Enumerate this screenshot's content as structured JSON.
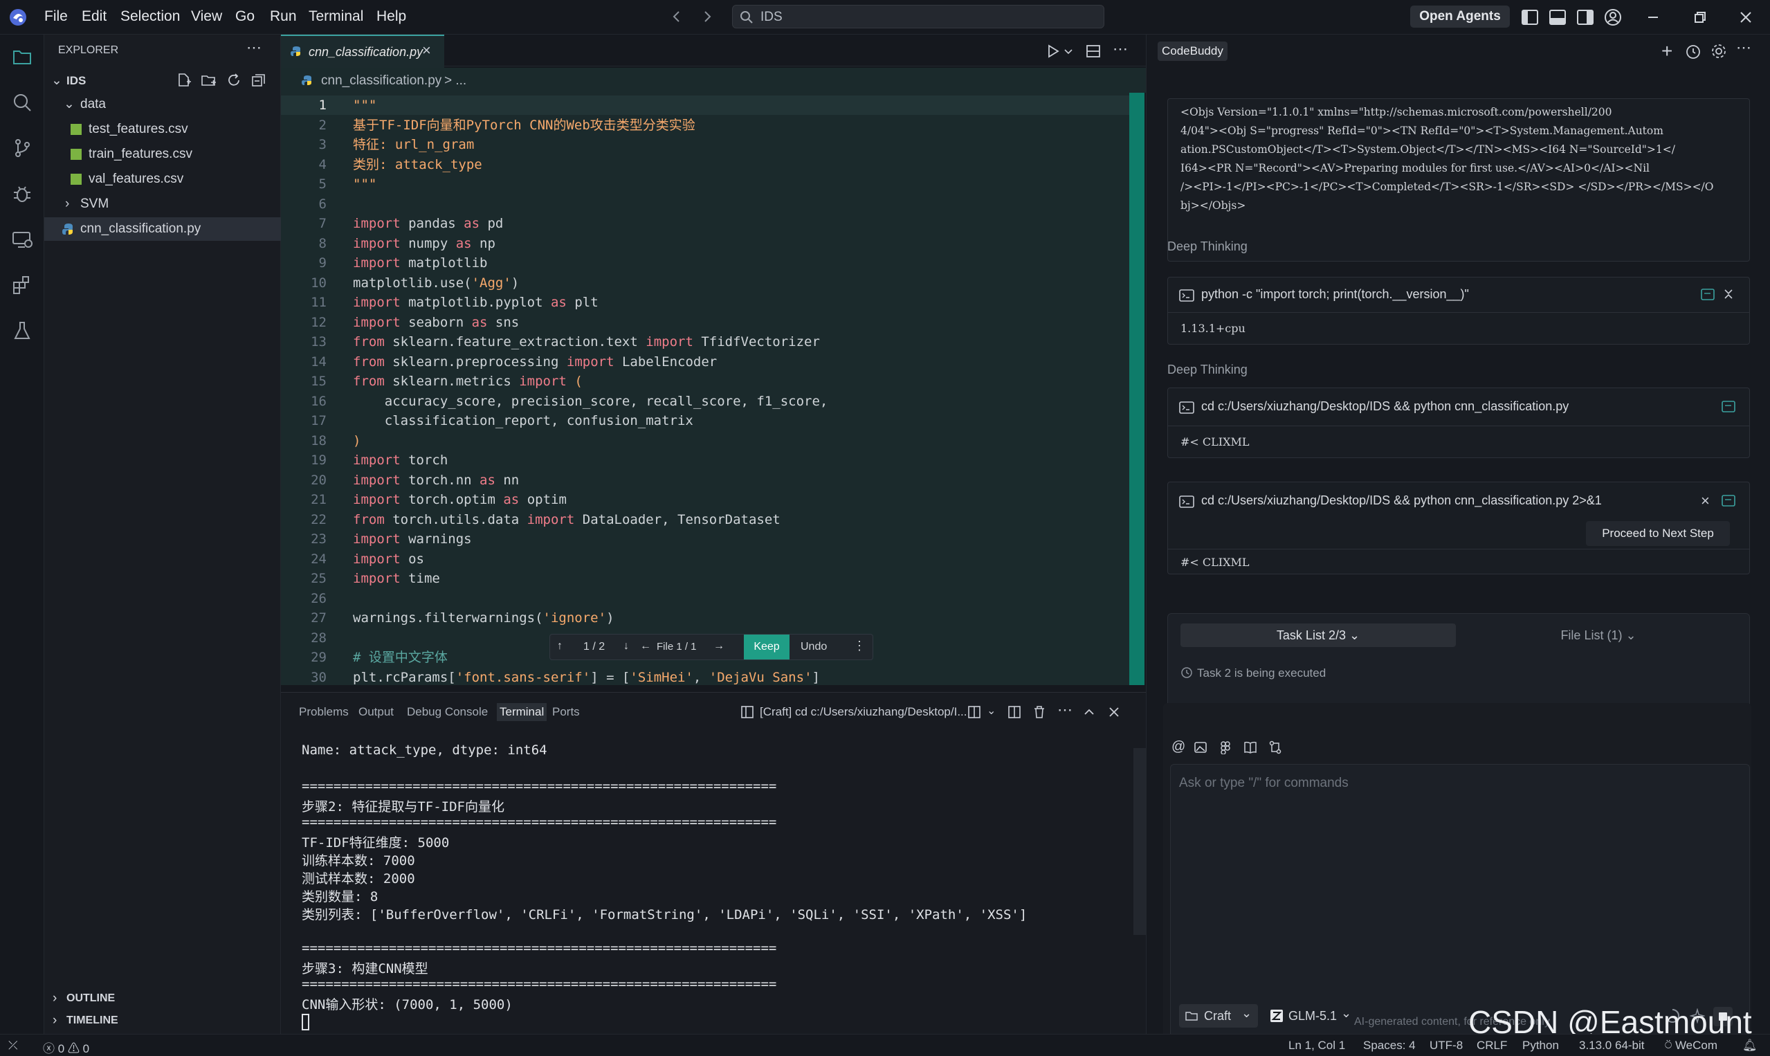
{
  "menu": [
    "File",
    "Edit",
    "Selection",
    "View",
    "Go",
    "Run",
    "Terminal",
    "Help"
  ],
  "search": {
    "text": "IDS"
  },
  "titlebar": {
    "open_agents": "Open Agents"
  },
  "explorer": {
    "title": "EXPLORER",
    "root": "IDS",
    "items": [
      {
        "label": "data",
        "kind": "folder-open"
      },
      {
        "label": "test_features.csv",
        "kind": "csv"
      },
      {
        "label": "train_features.csv",
        "kind": "csv"
      },
      {
        "label": "val_features.csv",
        "kind": "csv"
      },
      {
        "label": "SVM",
        "kind": "folder"
      },
      {
        "label": "cnn_classification.py",
        "kind": "py"
      }
    ],
    "outline": "OUTLINE",
    "timeline": "TIMELINE"
  },
  "editor": {
    "tab": "cnn_classification.py",
    "breadcrumb_file": "cnn_classification.py",
    "breadcrumb_rest": "> ...",
    "lines": [
      [
        [
          "doc",
          "\"\"\""
        ]
      ],
      [
        [
          "doc",
          "基于TF-IDF向量和PyTorch CNN的Web攻击类型分类实验"
        ]
      ],
      [
        [
          "doc",
          "特征: url_n_gram"
        ]
      ],
      [
        [
          "doc",
          "类别: attack_type"
        ]
      ],
      [
        [
          "doc",
          "\"\"\""
        ]
      ],
      [],
      [
        [
          "kw",
          "import"
        ],
        [
          "t",
          " pandas "
        ],
        [
          "kw",
          "as"
        ],
        [
          "t",
          " pd"
        ]
      ],
      [
        [
          "kw",
          "import"
        ],
        [
          "t",
          " numpy "
        ],
        [
          "kw",
          "as"
        ],
        [
          "t",
          " np"
        ]
      ],
      [
        [
          "kw",
          "import"
        ],
        [
          "t",
          " matplotlib"
        ]
      ],
      [
        [
          "t",
          "matplotlib.use("
        ],
        [
          "str",
          "'Agg'"
        ],
        [
          "t",
          ")"
        ]
      ],
      [
        [
          "kw",
          "import"
        ],
        [
          "t",
          " matplotlib.pyplot "
        ],
        [
          "kw",
          "as"
        ],
        [
          "t",
          " plt"
        ]
      ],
      [
        [
          "kw",
          "import"
        ],
        [
          "t",
          " seaborn "
        ],
        [
          "kw",
          "as"
        ],
        [
          "t",
          " sns"
        ]
      ],
      [
        [
          "kw",
          "from"
        ],
        [
          "t",
          " sklearn.feature_extraction.text "
        ],
        [
          "kw",
          "import"
        ],
        [
          "t",
          " TfidfVectorizer"
        ]
      ],
      [
        [
          "kw",
          "from"
        ],
        [
          "t",
          " sklearn.preprocessing "
        ],
        [
          "kw",
          "import"
        ],
        [
          "t",
          " LabelEncoder"
        ]
      ],
      [
        [
          "kw",
          "from"
        ],
        [
          "t",
          " sklearn.metrics "
        ],
        [
          "kw",
          "import"
        ],
        [
          "str",
          " ("
        ]
      ],
      [
        [
          "t",
          "    accuracy_score, precision_score, recall_score, f1_score,"
        ]
      ],
      [
        [
          "t",
          "    classification_report, confusion_matrix"
        ]
      ],
      [
        [
          "str",
          ")"
        ]
      ],
      [
        [
          "kw",
          "import"
        ],
        [
          "t",
          " torch"
        ]
      ],
      [
        [
          "kw",
          "import"
        ],
        [
          "t",
          " torch.nn "
        ],
        [
          "kw",
          "as"
        ],
        [
          "t",
          " nn"
        ]
      ],
      [
        [
          "kw",
          "import"
        ],
        [
          "t",
          " torch.optim "
        ],
        [
          "kw",
          "as"
        ],
        [
          "t",
          " optim"
        ]
      ],
      [
        [
          "kw",
          "from"
        ],
        [
          "t",
          " torch.utils.data "
        ],
        [
          "kw",
          "import"
        ],
        [
          "t",
          " DataLoader, TensorDataset"
        ]
      ],
      [
        [
          "kw",
          "import"
        ],
        [
          "t",
          " warnings"
        ]
      ],
      [
        [
          "kw",
          "import"
        ],
        [
          "t",
          " os"
        ]
      ],
      [
        [
          "kw",
          "import"
        ],
        [
          "t",
          " time"
        ]
      ],
      [],
      [
        [
          "t",
          "warnings.filterwarnings("
        ],
        [
          "str",
          "'ignore'"
        ],
        [
          "t",
          ")"
        ]
      ],
      [],
      [
        [
          "cm",
          "# 设置中文字体"
        ]
      ],
      [
        [
          "t",
          "plt.rcParams["
        ],
        [
          "str",
          "'font.sans-serif'"
        ],
        [
          "t",
          "] = ["
        ],
        [
          "str",
          "'SimHei'"
        ],
        [
          "t",
          ", "
        ],
        [
          "str",
          "'DejaVu Sans'"
        ],
        [
          "t",
          "]"
        ]
      ]
    ],
    "inline_toolbar": {
      "hunk": "1 / 2",
      "file": "File 1 / 1",
      "keep": "Keep",
      "undo": "Undo"
    }
  },
  "panel": {
    "tabs": [
      "Problems",
      "Output",
      "Debug Console",
      "Terminal",
      "Ports"
    ],
    "active_tab": "Terminal",
    "terminal_title": "[Craft] cd c:/Users/xiuzhang/Desktop/I...",
    "lines": [
      "Name: attack_type, dtype: int64",
      "",
      "============================================================",
      "步骤2: 特征提取与TF-IDF向量化",
      "============================================================",
      "TF-IDF特征维度: 5000",
      "训练样本数: 7000",
      "测试样本数: 2000",
      "类别数量: 8",
      "类别列表: ['BufferOverflow', 'CRLFi', 'FormatString', 'LDAPi', 'SQLi', 'SSI', 'XPath', 'XSS']",
      "",
      "============================================================",
      "步骤3: 构建CNN模型",
      "============================================================",
      "CNN输入形状: (7000, 1, 5000)"
    ]
  },
  "codebuddy": {
    "title": "CodeBuddy",
    "xml_output": [
      "<Objs Version=\"1.1.0.1\" xmlns=\"http://schemas.microsoft.com/powershell/200",
      "4/04\"><Obj S=\"progress\" RefId=\"0\"><TN RefId=\"0\"><T>System.Management.Autom",
      "ation.PSCustomObject</T><T>System.Object</T></TN><MS><I64 N=\"SourceId\">1</",
      "I64><PR N=\"Record\"><AV>Preparing modules for first use.</AV><AI>0</AI><Nil",
      "/><PI>-1</PI><PC>-1</PC><T>Completed</T><SR>-1</SR><SD> </SD></PR></MS></O",
      "bj></Objs>"
    ],
    "deep_thinking": "Deep Thinking",
    "cmd1": "python -c \"import torch; print(torch.__version__)\"",
    "out1": "1.13.1+cpu",
    "cmd2": "cd c:/Users/xiuzhang/Desktop/IDS && python cnn_classification.py",
    "out2": "#< CLIXML",
    "cmd3": "cd c:/Users/xiuzhang/Desktop/IDS && python cnn_classification.py 2>&1",
    "proceed": "Proceed to Next Step",
    "out3": "#< CLIXML",
    "task_list": "Task List 2/3",
    "file_list": "File List (1)",
    "task_status": "Task 2 is being executed",
    "input_placeholder": "Ask or type \"/\" for commands",
    "mode": "Craft",
    "model": "GLM-5.1",
    "disclaimer": "AI-generated content, for reference only"
  },
  "watermark": "CSDN @Eastmount",
  "statusbar": {
    "errors": "0",
    "warnings": "0",
    "position": "Ln 1, Col 1",
    "spaces": "Spaces: 4",
    "encoding": "UTF-8",
    "eol": "CRLF",
    "language": "Python",
    "interpreter": "3.13.0 64-bit",
    "wecom": "WeCom"
  }
}
